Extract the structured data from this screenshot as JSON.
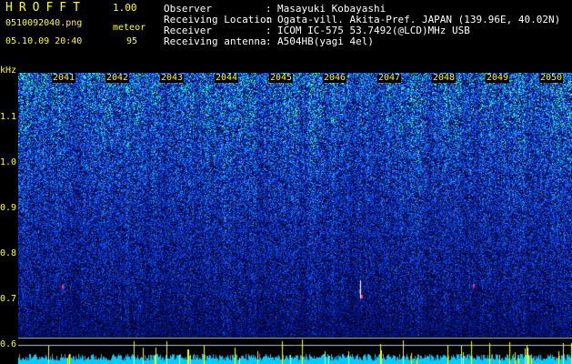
{
  "app": {
    "title": "HROFFT",
    "version": "1.00",
    "filename": "0510092040.png",
    "datetime": "05.10.09 20:40"
  },
  "meteor": {
    "label": "meteor",
    "count": "95"
  },
  "info": [
    {
      "label": "Observer",
      "value": "Masayuki Kobayashi"
    },
    {
      "label": "Receiving Location",
      "value": "Ogata-vill. Akita-Pref. JAPAN (139.96E, 40.02N)"
    },
    {
      "label": "Receiver",
      "value": "ICOM IC-575 53.7492(@LCD)MHz USB"
    },
    {
      "label": "Receiving antenna",
      "value": "A504HB(yagi 4el)"
    }
  ],
  "spectrogram": {
    "y_unit": "kHz",
    "y_ticks": [
      "1.1",
      "1.0",
      "0.9",
      "0.8",
      "0.7",
      "0.6"
    ],
    "x_ticks": [
      "2041",
      "2042",
      "2043",
      "2044",
      "2045",
      "2046",
      "2047",
      "2048",
      "2049",
      "2050"
    ],
    "colors": {
      "background": "#000033",
      "low": "#001a8c",
      "mid": "#1a5cff",
      "high": "#2fffbf",
      "peak": "#ffff00",
      "baseline": "#00ccff",
      "meteor_echo": "#ff3366"
    }
  }
}
